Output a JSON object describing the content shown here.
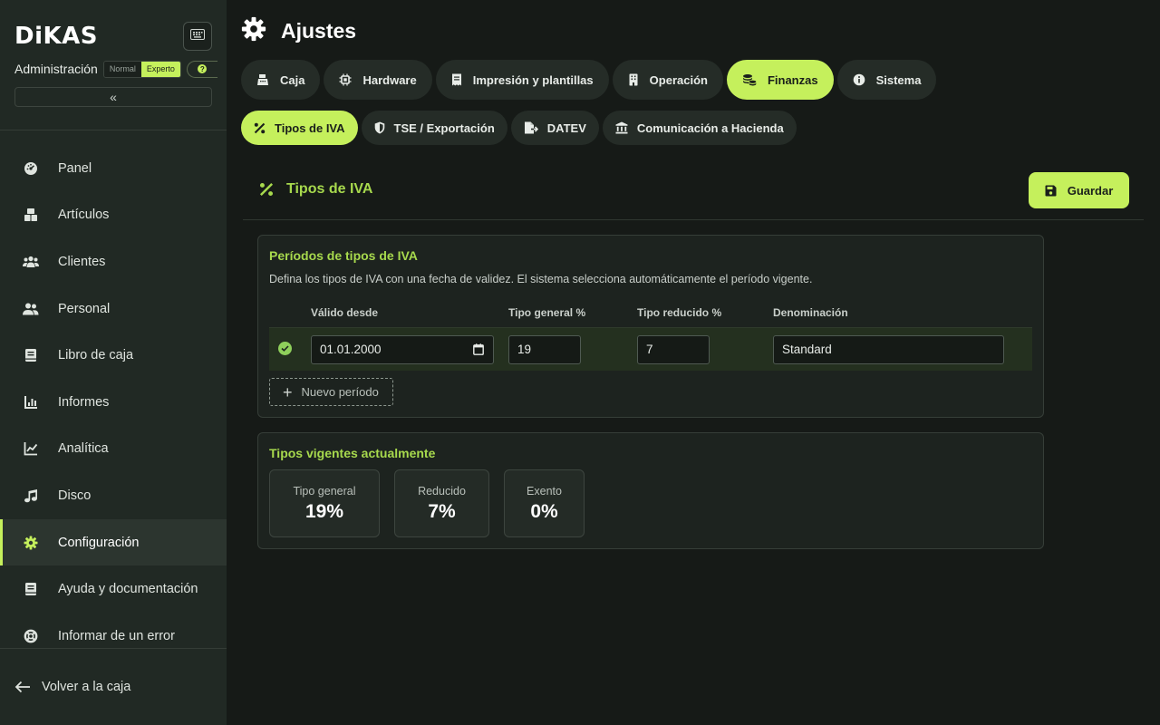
{
  "app": {
    "logo": "DiKAS"
  },
  "sidebar": {
    "admin_label": "Administración",
    "modes": [
      "Normal",
      "Experto"
    ],
    "active_mode": "Experto",
    "collapse_glyph": "«",
    "items": [
      {
        "label": "Panel",
        "icon": "dashboard-icon"
      },
      {
        "label": "Artículos",
        "icon": "boxes-icon"
      },
      {
        "label": "Clientes",
        "icon": "users-icon"
      },
      {
        "label": "Personal",
        "icon": "staff-icon"
      },
      {
        "label": "Libro de caja",
        "icon": "book-icon"
      },
      {
        "label": "Informes",
        "icon": "bar-chart-icon"
      },
      {
        "label": "Analítica",
        "icon": "line-chart-icon"
      },
      {
        "label": "Disco",
        "icon": "music-icon"
      },
      {
        "label": "Configuración",
        "icon": "gear-icon",
        "active": true
      },
      {
        "label": "Ayuda y documentación",
        "icon": "docs-icon"
      },
      {
        "label": "Informar de un error",
        "icon": "lifebuoy-icon"
      }
    ],
    "back_label": "Volver a la caja"
  },
  "header": {
    "title": "Ajustes"
  },
  "tabs": [
    {
      "label": "Caja",
      "icon": "register-icon"
    },
    {
      "label": "Hardware",
      "icon": "chip-icon"
    },
    {
      "label": "Impresión y plantillas",
      "icon": "receipt-icon"
    },
    {
      "label": "Operación",
      "icon": "building-icon"
    },
    {
      "label": "Finanzas",
      "icon": "coins-icon",
      "active": true
    },
    {
      "label": "Sistema",
      "icon": "info-icon"
    }
  ],
  "subtabs": [
    {
      "label": "Tipos de IVA",
      "icon": "percent-icon",
      "active": true
    },
    {
      "label": "TSE / Exportación",
      "icon": "shield-icon"
    },
    {
      "label": "DATEV",
      "icon": "file-export-icon"
    },
    {
      "label": "Comunicación a Hacienda",
      "icon": "bank-icon"
    }
  ],
  "section": {
    "title": "Tipos de IVA",
    "save_label": "Guardar"
  },
  "periods": {
    "title": "Períodos de tipos de IVA",
    "description": "Defina los tipos de IVA con una fecha de validez. El sistema selecciona automáticamente el período vigente.",
    "columns": [
      "Válido desde",
      "Tipo general %",
      "Tipo reducido %",
      "Denominación"
    ],
    "rows": [
      {
        "valid_from": "01.01.2000",
        "general": "19",
        "reduced": "7",
        "name": "Standard",
        "active": true
      }
    ],
    "new_label": "Nuevo período"
  },
  "current": {
    "title": "Tipos vigentes actualmente",
    "rates": [
      {
        "label": "Tipo general",
        "value": "19%"
      },
      {
        "label": "Reducido",
        "value": "7%"
      },
      {
        "label": "Exento",
        "value": "0%"
      }
    ]
  },
  "colors": {
    "accent": "#c5f05c",
    "accent_text": "#a7d94d",
    "background": "#161a17",
    "sidebar": "#212924"
  }
}
